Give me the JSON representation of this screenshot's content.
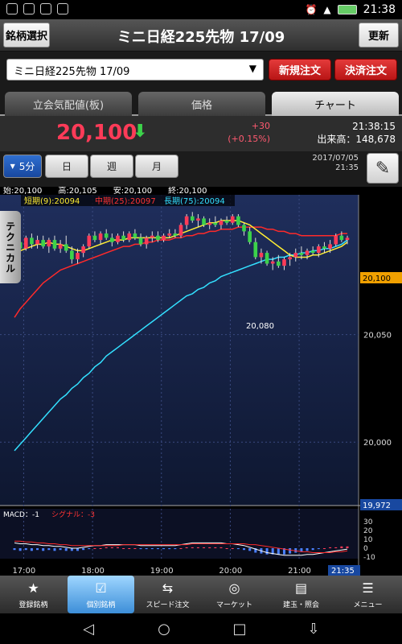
{
  "status_bar": {
    "time": "21:38"
  },
  "header": {
    "left_button": "銘柄選択",
    "title": "ミニ日経225先物 17/09",
    "right_button": "更新"
  },
  "selector": {
    "value": "ミニ日経225先物 17/09",
    "new_order": "新規注文",
    "close_order": "決済注文"
  },
  "tabs": [
    {
      "label": "立会気配値(板)"
    },
    {
      "label": "価格"
    },
    {
      "label": "チャート"
    }
  ],
  "price": {
    "last": "20,100",
    "change": "+30",
    "change_pct": "(+0.15%)",
    "time": "21:38:15",
    "volume": "出来高：148,678",
    "up_color": "#ff3b58",
    "down_arrow_color": "#3cd24a"
  },
  "period": {
    "buttons": [
      "5分",
      "日",
      "週",
      "月"
    ],
    "selected": "5分",
    "chart_date": "2017/07/05",
    "chart_time": "21:35"
  },
  "chart_info": {
    "ohlc": "始:20,100　　高:20,105　　安:20,100　　終:20,100",
    "ma_short": "短期(9):20094",
    "ma_mid": "中期(25):20097",
    "ma_long": "長期(75):20094",
    "tech_tab": "テクニカル",
    "low_label": "20,080",
    "price_tag": "20,100",
    "price_tag_bottom": "19,972",
    "macd_label": "MACD：-1",
    "signal_label": "シグナル：-3",
    "time_tag": "21:35"
  },
  "chart_data": {
    "type": "candlestick",
    "y_ticks": [
      "20,050",
      "20,000"
    ],
    "macd_ticks": [
      "30",
      "20",
      "10",
      "0",
      "-10"
    ],
    "x_ticks": [
      "17:00",
      "18:00",
      "19:00",
      "20:00",
      "21:00"
    ],
    "ylim": [
      19972,
      20112
    ],
    "candles": [
      [
        20080,
        20095,
        20078,
        20093
      ],
      [
        20093,
        20096,
        20088,
        20090
      ],
      [
        20090,
        20096,
        20089,
        20095
      ],
      [
        20095,
        20097,
        20090,
        20092
      ],
      [
        20092,
        20096,
        20090,
        20094
      ],
      [
        20094,
        20096,
        20090,
        20091
      ],
      [
        20091,
        20095,
        20088,
        20094
      ],
      [
        20094,
        20096,
        20089,
        20090
      ],
      [
        20090,
        20094,
        20088,
        20092
      ],
      [
        20092,
        20096,
        20088,
        20089
      ],
      [
        20089,
        20091,
        20083,
        20085
      ],
      [
        20085,
        20090,
        20083,
        20088
      ],
      [
        20088,
        20092,
        20086,
        20091
      ],
      [
        20091,
        20097,
        20090,
        20096
      ],
      [
        20096,
        20098,
        20093,
        20094
      ],
      [
        20094,
        20098,
        20092,
        20097
      ],
      [
        20097,
        20099,
        20094,
        20095
      ],
      [
        20095,
        20097,
        20091,
        20093
      ],
      [
        20093,
        20097,
        20092,
        20096
      ],
      [
        20096,
        20098,
        20093,
        20094
      ],
      [
        20094,
        20098,
        20093,
        20097
      ],
      [
        20097,
        20099,
        20094,
        20095
      ],
      [
        20095,
        20097,
        20091,
        20092
      ],
      [
        20092,
        20096,
        20090,
        20095
      ],
      [
        20095,
        20098,
        20093,
        20096
      ],
      [
        20096,
        20098,
        20093,
        20094
      ],
      [
        20094,
        20097,
        20093,
        20096
      ],
      [
        20096,
        20099,
        20095,
        20097
      ],
      [
        20097,
        20099,
        20095,
        20096
      ],
      [
        20096,
        20102,
        20095,
        20101
      ],
      [
        20101,
        20106,
        20099,
        20105
      ],
      [
        20105,
        20107,
        20102,
        20103
      ],
      [
        20103,
        20106,
        20100,
        20104
      ],
      [
        20104,
        20105,
        20100,
        20101
      ],
      [
        20101,
        20104,
        20099,
        20102
      ],
      [
        20102,
        20105,
        20100,
        20101
      ],
      [
        20101,
        20104,
        20099,
        20103
      ],
      [
        20103,
        20105,
        20101,
        20102
      ],
      [
        20102,
        20106,
        20101,
        20105
      ],
      [
        20105,
        20106,
        20100,
        20101
      ],
      [
        20101,
        20102,
        20096,
        20098
      ],
      [
        20098,
        20100,
        20092,
        20093
      ],
      [
        20093,
        20095,
        20085,
        20086
      ],
      [
        20086,
        20090,
        20083,
        20088
      ],
      [
        20088,
        20089,
        20082,
        20083
      ],
      [
        20083,
        20086,
        20080,
        20084
      ],
      [
        20084,
        20087,
        20081,
        20082
      ],
      [
        20082,
        20086,
        20080,
        20085
      ],
      [
        20085,
        20088,
        20082,
        20086
      ],
      [
        20086,
        20090,
        20084,
        20088
      ],
      [
        20088,
        20091,
        20085,
        20087
      ],
      [
        20087,
        20090,
        20085,
        20089
      ],
      [
        20089,
        20091,
        20087,
        20088
      ],
      [
        20088,
        20092,
        20086,
        20091
      ],
      [
        20091,
        20093,
        20088,
        20090
      ],
      [
        20090,
        20094,
        20088,
        20092
      ],
      [
        20092,
        20097,
        20091,
        20096
      ],
      [
        20096,
        20098,
        20093,
        20094
      ],
      [
        20094,
        20096,
        20092,
        20095
      ]
    ],
    "ma_short_values": [
      20088,
      20089,
      20090,
      20091,
      20092,
      20092,
      20093,
      20092,
      20092,
      20091,
      20090,
      20089,
      20089,
      20090,
      20091,
      20092,
      20093,
      20094,
      20094,
      20094,
      20095,
      20095,
      20095,
      20095,
      20095,
      20095,
      20095,
      20095,
      20096,
      20097,
      20098,
      20099,
      20100,
      20101,
      20102,
      20102,
      20103,
      20103,
      20103,
      20103,
      20102,
      20101,
      20099,
      20097,
      20095,
      20093,
      20091,
      20089,
      20087,
      20086,
      20086,
      20086,
      20087,
      20087,
      20088,
      20089,
      20090,
      20091,
      20093
    ],
    "ma_mid_values": [
      20058,
      20062,
      20065,
      20068,
      20071,
      20074,
      20076,
      20078,
      20080,
      20081,
      20082,
      20083,
      20084,
      20085,
      20086,
      20087,
      20088,
      20089,
      20090,
      20091,
      20091,
      20092,
      20092,
      20093,
      20093,
      20094,
      20094,
      20094,
      20095,
      20095,
      20096,
      20096,
      20097,
      20097,
      20098,
      20098,
      20099,
      20099,
      20099,
      20100,
      20100,
      20100,
      20100,
      20100,
      20099,
      20099,
      20098,
      20098,
      20097,
      20097,
      20096,
      20096,
      20096,
      20096,
      20096,
      20096,
      20096,
      20097,
      20097
    ],
    "ma_long_values": [
      19996,
      19999,
      20002,
      20005,
      20008,
      20011,
      20014,
      20017,
      20020,
      20022,
      20025,
      20027,
      20030,
      20032,
      20035,
      20037,
      20040,
      20042,
      20044,
      20046,
      20048,
      20050,
      20052,
      20054,
      20056,
      20058,
      20060,
      20062,
      20064,
      20066,
      20068,
      20069,
      20071,
      20072,
      20074,
      20075,
      20077,
      20078,
      20079,
      20080,
      20081,
      20082,
      20083,
      20084,
      20085,
      20085,
      20086,
      20086,
      20087,
      20087,
      20088,
      20088,
      20089,
      20089,
      20090,
      20090,
      20091,
      20092,
      20094
    ],
    "macd_values": [
      6,
      5,
      5,
      4,
      4,
      3,
      3,
      2,
      2,
      1,
      0,
      0,
      1,
      2,
      3,
      3,
      4,
      4,
      4,
      4,
      4,
      4,
      3,
      3,
      3,
      3,
      3,
      3,
      3,
      4,
      5,
      6,
      6,
      6,
      6,
      6,
      6,
      5,
      5,
      4,
      3,
      1,
      -1,
      -3,
      -5,
      -6,
      -7,
      -8,
      -8,
      -8,
      -8,
      -7,
      -7,
      -6,
      -5,
      -4,
      -3,
      -2,
      -1
    ],
    "signal_values": [
      8,
      8,
      7,
      7,
      6,
      6,
      5,
      5,
      4,
      4,
      3,
      3,
      3,
      3,
      3,
      3,
      3,
      3,
      3,
      4,
      4,
      4,
      4,
      4,
      4,
      4,
      4,
      4,
      4,
      4,
      4,
      5,
      5,
      5,
      5,
      5,
      5,
      5,
      5,
      5,
      5,
      4,
      4,
      3,
      2,
      1,
      0,
      -1,
      -2,
      -3,
      -4,
      -4,
      -5,
      -5,
      -5,
      -5,
      -4,
      -4,
      -3
    ]
  },
  "bottom_nav": [
    {
      "label": "登録銘柄"
    },
    {
      "label": "個別銘柄"
    },
    {
      "label": "スピード注文"
    },
    {
      "label": "マーケット"
    },
    {
      "label": "建玉・照会"
    },
    {
      "label": "メニュー"
    }
  ]
}
